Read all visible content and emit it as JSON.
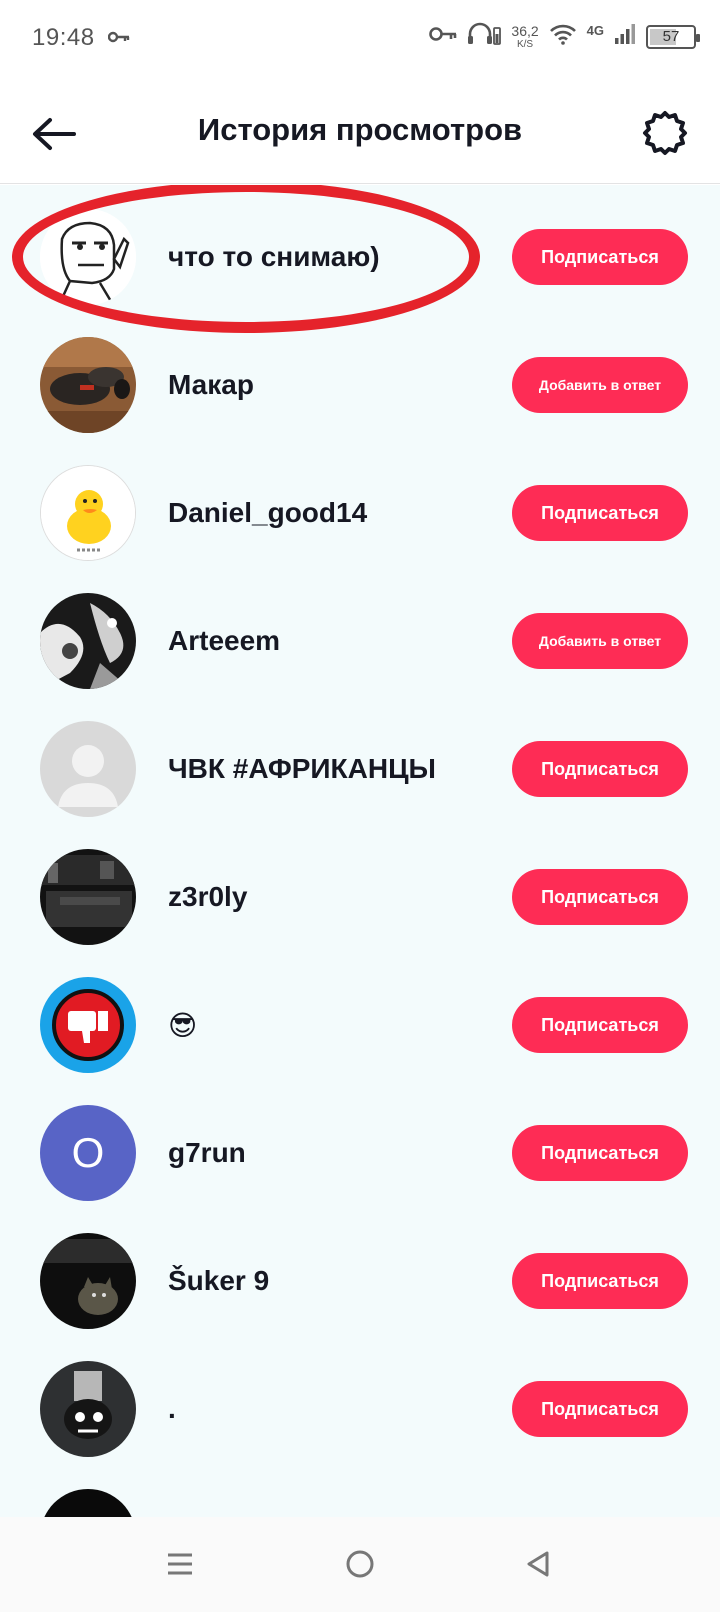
{
  "status_bar": {
    "time": "19:48",
    "speed_value": "36,2",
    "speed_unit": "K/S",
    "network": "4G",
    "battery": "57"
  },
  "header": {
    "title": "История просмотров",
    "back_icon": "arrow-left-icon",
    "settings_icon": "gear-icon"
  },
  "list": [
    {
      "username": "что то снимаю)",
      "button": "Подписаться",
      "avatar": "meme-face",
      "highlighted": true
    },
    {
      "username": "Макар",
      "button": "Добавить в ответ",
      "avatar": "photo-shoes"
    },
    {
      "username": "Daniel_good14",
      "button": "Подписаться",
      "avatar": "duck"
    },
    {
      "username": "Arteeem",
      "button": "Добавить в ответ",
      "avatar": "bw-photo"
    },
    {
      "username": "ЧВК #АФРИКАНЦЫ",
      "button": "Подписаться",
      "avatar": "default-user"
    },
    {
      "username": "z3r0ly",
      "button": "Подписаться",
      "avatar": "dark-photo"
    },
    {
      "username": "😎",
      "button": "Подписаться",
      "avatar": "dislike-logo"
    },
    {
      "username": "g7run",
      "button": "Подписаться",
      "avatar": "letter",
      "avatar_letter": "O"
    },
    {
      "username": "Šuker 9",
      "button": "Подписаться",
      "avatar": "dark-cat"
    },
    {
      "username": ".",
      "button": "Подписаться",
      "avatar": "face-photo"
    }
  ],
  "colors": {
    "accent": "#fe2c55",
    "list_background": "#f3fbfc",
    "highlight_ring": "#e5232b"
  },
  "nav_bar": {
    "menu_icon": "menu-lines-icon",
    "home_icon": "home-circle-icon",
    "back_icon": "back-triangle-icon"
  }
}
